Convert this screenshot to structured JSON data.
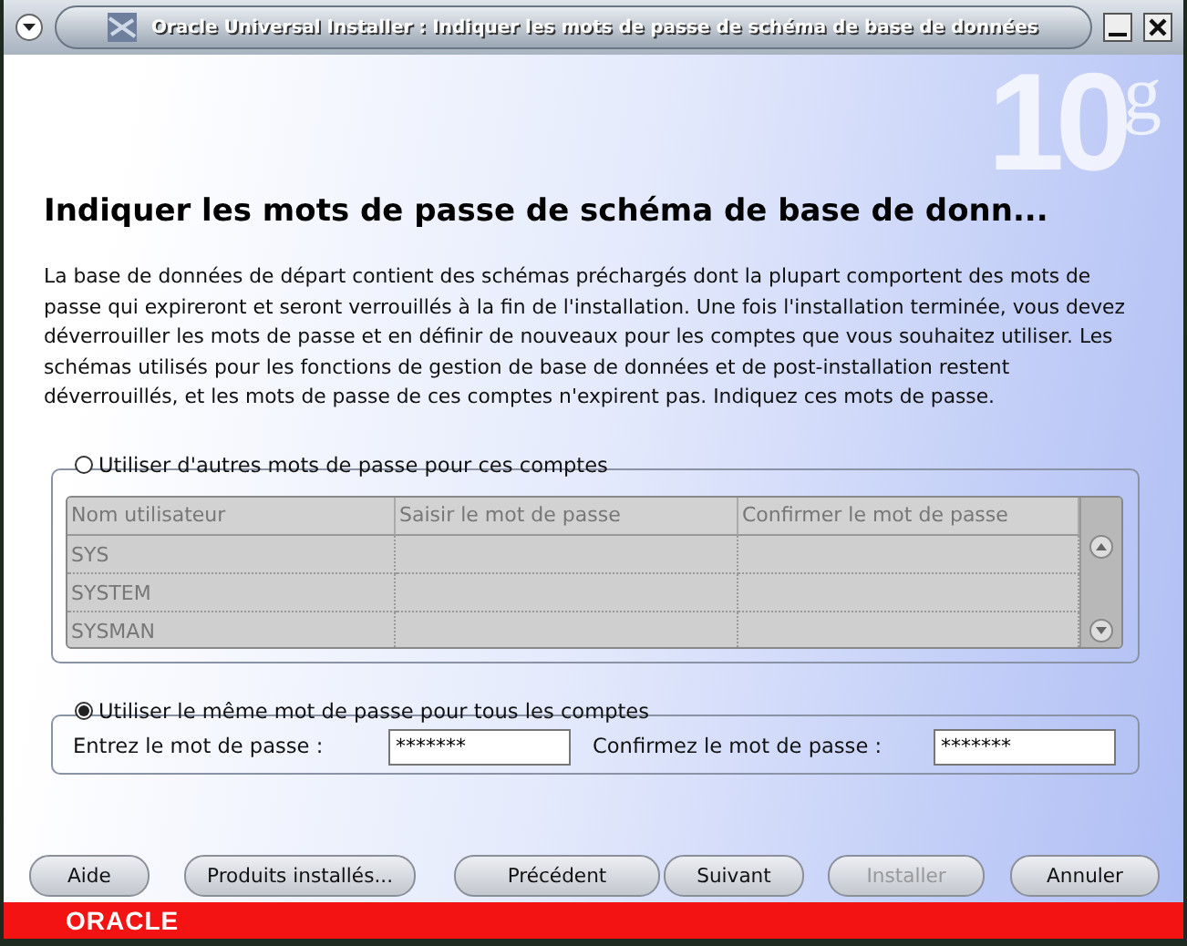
{
  "window": {
    "title": "Oracle Universal Installer : Indiquer les mots de passe de schéma de base de données"
  },
  "logo": {
    "number": "10",
    "letter": "g"
  },
  "heading": "Indiquer les mots de passe de schéma de base de donn...",
  "description": "La base de données de départ contient des schémas préchargés dont la plupart comportent des mots de passe qui expireront et seront verrouillés à la fin de l'installation. Une fois l'installation terminée, vous devez déverrouiller  les mots de passe et en définir de nouveaux pour les comptes que vous souhaitez utiliser. Les schémas utilisés pour les fonctions de gestion de base de données et de post-installation restent déverrouillés, et les mots de passe de ces comptes n'expirent pas. Indiquez ces mots de passe.",
  "options": [
    {
      "label": "Utiliser d'autres mots de passe pour ces comptes",
      "selected": false
    },
    {
      "label": "Utiliser le même mot de passe pour tous les comptes",
      "selected": true
    }
  ],
  "table": {
    "disabled": true,
    "columns": [
      "Nom utilisateur",
      "Saisir le mot de passe",
      "Confirmer le mot de passe"
    ],
    "rows": [
      [
        "SYS",
        "",
        ""
      ],
      [
        "SYSTEM",
        "",
        ""
      ],
      [
        "SYSMAN",
        "",
        ""
      ]
    ]
  },
  "fields": [
    {
      "label": "Entrez le mot de passe :",
      "value": "*******"
    },
    {
      "label": "Confirmez le mot de passe :",
      "value": "*******"
    }
  ],
  "buttons": [
    {
      "label": "Aide",
      "disabled": false
    },
    {
      "label": "Produits installés...",
      "disabled": false
    },
    {
      "label": "Précédent",
      "disabled": false
    },
    {
      "label": "Suivant",
      "disabled": false
    },
    {
      "label": "Installer",
      "disabled": true
    },
    {
      "label": "Annuler",
      "disabled": false
    }
  ],
  "brand": "ORACLE"
}
